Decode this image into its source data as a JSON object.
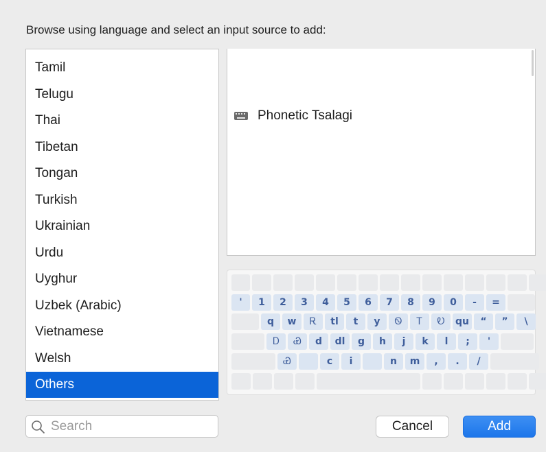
{
  "prompt": "Browse using language and select an input source to add:",
  "languages": [
    {
      "label": "Tamil",
      "selected": false
    },
    {
      "label": "Telugu",
      "selected": false
    },
    {
      "label": "Thai",
      "selected": false
    },
    {
      "label": "Tibetan",
      "selected": false
    },
    {
      "label": "Tongan",
      "selected": false
    },
    {
      "label": "Turkish",
      "selected": false
    },
    {
      "label": "Ukrainian",
      "selected": false
    },
    {
      "label": "Urdu",
      "selected": false
    },
    {
      "label": "Uyghur",
      "selected": false
    },
    {
      "label": "Uzbek (Arabic)",
      "selected": false
    },
    {
      "label": "Vietnamese",
      "selected": false
    },
    {
      "label": "Welsh",
      "selected": false
    },
    {
      "label": "Others",
      "selected": true
    }
  ],
  "input_sources": [
    {
      "label": "Phonetic Tsalagi",
      "icon": "keyboard-icon"
    }
  ],
  "keyboard_preview": {
    "rows": [
      [],
      [
        "'",
        "1",
        "2",
        "3",
        "4",
        "5",
        "6",
        "7",
        "8",
        "9",
        "0",
        "-",
        "="
      ],
      [
        "q",
        "w",
        "Ꭱ",
        "tl",
        "t",
        "y",
        "Ꮻ",
        "Ꭲ",
        "Ꭷ",
        "qu",
        "“",
        "”",
        "\\"
      ],
      [
        "Ꭰ",
        "Ꮿ",
        "d",
        "dl",
        "g",
        "h",
        "j",
        "k",
        "l",
        ";",
        "'"
      ],
      [
        "Ꮿ",
        "",
        "c",
        "i",
        "",
        "n",
        "m",
        ",",
        ".",
        "/"
      ],
      []
    ]
  },
  "search": {
    "placeholder": "Search",
    "value": ""
  },
  "buttons": {
    "cancel": "Cancel",
    "add": "Add"
  },
  "colors": {
    "selection": "#0b64d8",
    "accent": "#1d76ea",
    "key_glyph": "#3f5e9b"
  }
}
